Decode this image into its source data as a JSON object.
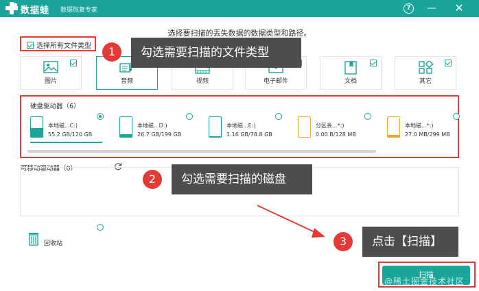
{
  "app": {
    "brand": "数据蛙",
    "subtitle": "数据恢复专家"
  },
  "window_buttons": {
    "help": "?",
    "minimize": "—",
    "close": "✕"
  },
  "instruction": "选择要扫描的丢失数据的数据类型和路径。",
  "select_all": {
    "label": "选择所有文件类型",
    "checked": true
  },
  "file_types": [
    {
      "label": "图片",
      "checked": true,
      "icon": "image-icon"
    },
    {
      "label": "音频",
      "checked": true,
      "icon": "audio-icon"
    },
    {
      "label": "视频",
      "checked": true,
      "icon": "video-icon"
    },
    {
      "label": "电子邮件",
      "checked": true,
      "icon": "email-icon"
    },
    {
      "label": "文档",
      "checked": true,
      "icon": "document-icon"
    },
    {
      "label": "其它",
      "checked": true,
      "icon": "other-icon"
    }
  ],
  "hard_drives": {
    "title": "硬盘驱动器（6）",
    "drives": [
      {
        "name": "本地磁...C:)",
        "size": "55.2 GB/120 GB",
        "selected": true,
        "usage": 0.46,
        "color": "#1aa49a"
      },
      {
        "name": "本地磁...D:)",
        "size": "26.7 GB/199 GB",
        "selected": false,
        "usage": 0.13,
        "color": "#1aa49a"
      },
      {
        "name": "本地磁...E:)",
        "size": "1.16 GB/78.8 GB",
        "selected": false,
        "usage": 0.02,
        "color": "#1aa49a"
      },
      {
        "name": "分区丢...*:)",
        "size": "0.00  B/128 MB",
        "selected": false,
        "usage": 0.0,
        "color": "#f0a830"
      },
      {
        "name": "本地磁...*:)",
        "size": "27.0 MB/299 MB",
        "selected": false,
        "usage": 0.09,
        "color": "#f0a830"
      }
    ]
  },
  "removable": {
    "title": "可移动驱动器（0）"
  },
  "recycle": {
    "label": "回收站"
  },
  "callouts": [
    {
      "number": "1",
      "text": "勾选需要扫描的文件类型"
    },
    {
      "number": "2",
      "text": "勾选需要扫描的磁盘"
    },
    {
      "number": "3",
      "text": "点击【扫描】"
    }
  ],
  "scan_button": {
    "label": "扫描"
  },
  "watermark": "@稀土掘金技术社区",
  "colors": {
    "accent": "#1aa49a",
    "highlight": "#e53935",
    "callout_bg": "#4d4d4d"
  }
}
